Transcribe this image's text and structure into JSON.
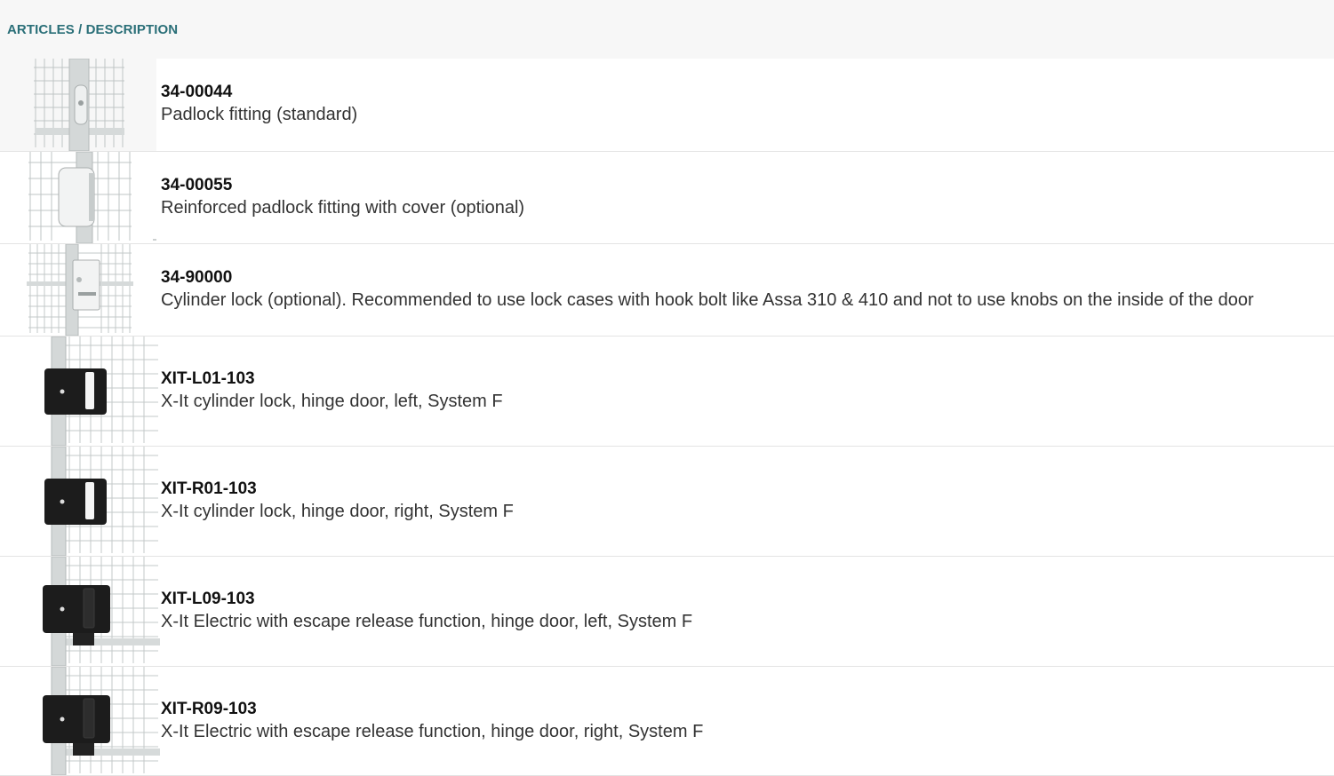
{
  "header": {
    "title": "ARTICLES / DESCRIPTION"
  },
  "articles": [
    {
      "code": "34-00044",
      "description": "Padlock fitting (standard)",
      "image_icon": "padlock-fitting-icon"
    },
    {
      "code": "34-00055",
      "description": "Reinforced padlock fitting with cover (optional)",
      "image_icon": "reinforced-padlock-fitting-icon"
    },
    {
      "code": "34-90000",
      "description": "Cylinder lock (optional). Recommended to use lock cases with hook bolt like Assa 310 & 410 and not to use knobs on the inside of the door",
      "image_icon": "cylinder-lock-icon"
    },
    {
      "code": "XIT-L01-103",
      "description": "X-It cylinder lock, hinge door, left, System F",
      "image_icon": "xit-cylinder-lock-icon"
    },
    {
      "code": "XIT-R01-103",
      "description": "X-It cylinder lock, hinge door, right, System F",
      "image_icon": "xit-cylinder-lock-icon"
    },
    {
      "code": "XIT-L09-103",
      "description": "X-It Electric with escape release function, hinge door, left, System F",
      "image_icon": "xit-electric-lock-icon"
    },
    {
      "code": "XIT-R09-103",
      "description": "X-It Electric with escape release function, hinge door, right, System F",
      "image_icon": "xit-electric-lock-icon"
    }
  ],
  "colors": {
    "header_text": "#2a6f78",
    "header_bg": "#f7f7f7",
    "divider": "#e3e3e3",
    "lock_black": "#1c1c1c",
    "post_grey": "#c9cfcf"
  }
}
